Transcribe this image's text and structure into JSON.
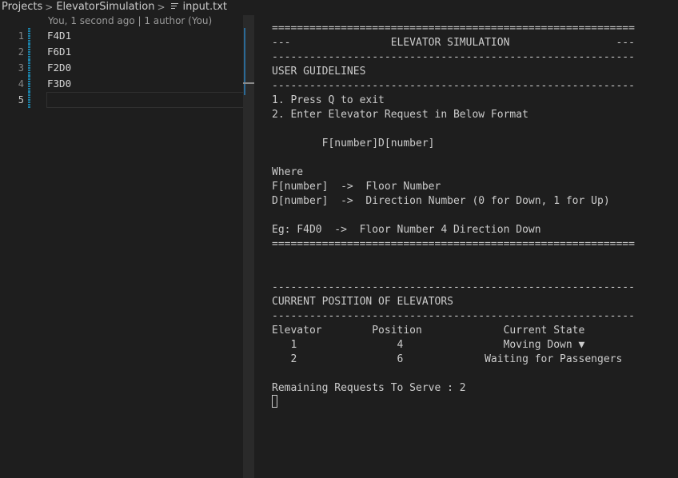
{
  "breadcrumb": {
    "items": [
      "Projects",
      "ElevatorSimulation",
      "input.txt"
    ],
    "separator": ">"
  },
  "blame": "You, 1 second ago | 1 author (You)",
  "code": {
    "lines": [
      {
        "number": "1",
        "text": "F4D1"
      },
      {
        "number": "2",
        "text": "F6D1"
      },
      {
        "number": "3",
        "text": "F2D0"
      },
      {
        "number": "4",
        "text": "F3D0"
      },
      {
        "number": "5",
        "text": ""
      }
    ],
    "current_line": "5"
  },
  "terminal": {
    "lines": [
      "==========================================================",
      "---                ELEVATOR SIMULATION                 ---",
      "----------------------------------------------------------",
      "USER GUIDELINES",
      "----------------------------------------------------------",
      "1. Press Q to exit",
      "2. Enter Elevator Request in Below Format",
      "",
      "        F[number]D[number]",
      "",
      "Where",
      "F[number]  ->  Floor Number",
      "D[number]  ->  Direction Number (0 for Down, 1 for Up)",
      "",
      "Eg: F4D0  ->  Floor Number 4 Direction Down",
      "==========================================================",
      "",
      "",
      "----------------------------------------------------------",
      "CURRENT POSITION OF ELEVATORS",
      "----------------------------------------------------------",
      "Elevator        Position             Current State",
      "   1                4                Moving Down ▼",
      "   2                6             Waiting for Passengers",
      "",
      "Remaining Requests To Serve : 2"
    ]
  },
  "colors": {
    "background": "#1e1e1e",
    "text": "#cccccc",
    "git_modified": "#1b81a8"
  },
  "icons": {
    "file": "lines-file-icon",
    "chevron": "chevron-right-icon"
  }
}
